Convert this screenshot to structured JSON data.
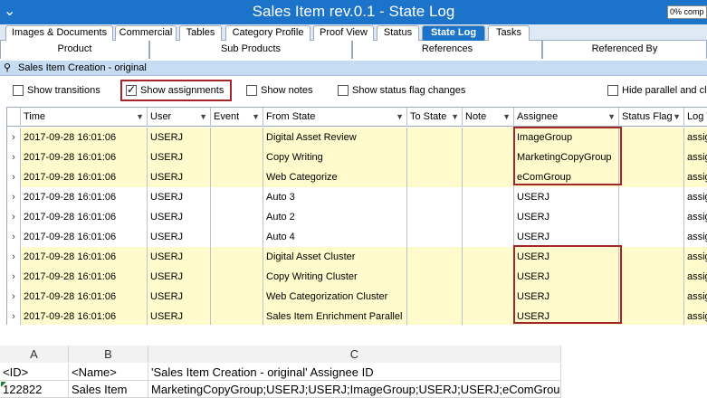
{
  "titlebar": {
    "title": "Sales Item rev.0.1 - State Log",
    "progress": "0% comp"
  },
  "tabs_row1": [
    {
      "label": "Images & Documents"
    },
    {
      "label": "Commercial"
    },
    {
      "label": "Tables"
    },
    {
      "label": "Category Profile"
    },
    {
      "label": "Proof View"
    },
    {
      "label": "Status"
    },
    {
      "label": "State Log",
      "active": true
    },
    {
      "label": "Tasks"
    }
  ],
  "tabs_row2": [
    {
      "label": "Product"
    },
    {
      "label": "Sub Products"
    },
    {
      "label": "References"
    },
    {
      "label": "Referenced By"
    }
  ],
  "breadcrumb": "Sales Item Creation - original",
  "checkboxes": {
    "show_transitions": {
      "label": "Show transitions",
      "checked": false
    },
    "show_assignments": {
      "label": "Show assignments",
      "checked": true
    },
    "show_notes": {
      "label": "Show notes",
      "checked": false
    },
    "show_status_flag_changes": {
      "label": "Show status flag changes",
      "checked": false
    },
    "hide_parallel": {
      "label": "Hide parallel and clu",
      "checked": false
    }
  },
  "grid": {
    "columns": [
      "Time",
      "User",
      "Event",
      "From State",
      "To State",
      "Note",
      "Assignee",
      "Status Flag",
      "Log T"
    ],
    "rows": [
      {
        "time": "2017-09-28 16:01:06",
        "user": "USERJ",
        "event": "",
        "from": "Digital Asset Review",
        "to": "",
        "note": "",
        "assignee": "ImageGroup",
        "flag": "",
        "log": "assig",
        "highlight": true
      },
      {
        "time": "2017-09-28 16:01:06",
        "user": "USERJ",
        "event": "",
        "from": "Copy Writing",
        "to": "",
        "note": "",
        "assignee": "MarketingCopyGroup",
        "flag": "",
        "log": "assig",
        "highlight": true
      },
      {
        "time": "2017-09-28 16:01:06",
        "user": "USERJ",
        "event": "",
        "from": "Web Categorize",
        "to": "",
        "note": "",
        "assignee": "eComGroup",
        "flag": "",
        "log": "assig",
        "highlight": true
      },
      {
        "time": "2017-09-28 16:01:06",
        "user": "USERJ",
        "event": "",
        "from": "Auto 3",
        "to": "",
        "note": "",
        "assignee": "USERJ",
        "flag": "",
        "log": "assig",
        "highlight": false
      },
      {
        "time": "2017-09-28 16:01:06",
        "user": "USERJ",
        "event": "",
        "from": "Auto 2",
        "to": "",
        "note": "",
        "assignee": "USERJ",
        "flag": "",
        "log": "assig",
        "highlight": false
      },
      {
        "time": "2017-09-28 16:01:06",
        "user": "USERJ",
        "event": "",
        "from": "Auto 4",
        "to": "",
        "note": "",
        "assignee": "USERJ",
        "flag": "",
        "log": "assig",
        "highlight": false
      },
      {
        "time": "2017-09-28 16:01:06",
        "user": "USERJ",
        "event": "",
        "from": "Digital Asset Cluster",
        "to": "",
        "note": "",
        "assignee": "USERJ",
        "flag": "",
        "log": "assig",
        "highlight": true
      },
      {
        "time": "2017-09-28 16:01:06",
        "user": "USERJ",
        "event": "",
        "from": "Copy Writing Cluster",
        "to": "",
        "note": "",
        "assignee": "USERJ",
        "flag": "",
        "log": "assig",
        "highlight": true
      },
      {
        "time": "2017-09-28 16:01:06",
        "user": "USERJ",
        "event": "",
        "from": "Web Categorization Cluster",
        "to": "",
        "note": "",
        "assignee": "USERJ",
        "flag": "",
        "log": "assig",
        "highlight": true
      },
      {
        "time": "2017-09-28 16:01:06",
        "user": "USERJ",
        "event": "",
        "from": "Sales Item Enrichment Parallel",
        "to": "",
        "note": "",
        "assignee": "USERJ",
        "flag": "",
        "log": "assig",
        "highlight": true
      }
    ]
  },
  "spreadsheet": {
    "col_headers": [
      "A",
      "B",
      "C"
    ],
    "rows": [
      [
        "<ID>",
        "<Name>",
        "'Sales Item Creation - original' Assignee ID"
      ],
      [
        "122822",
        "Sales Item",
        "MarketingCopyGroup;USERJ;USERJ;ImageGroup;USERJ;USERJ;eComGroup"
      ]
    ]
  },
  "colors": {
    "accent": "#1b74c9",
    "highlight_row": "#fffbcc",
    "annotation": "#a4252b"
  }
}
